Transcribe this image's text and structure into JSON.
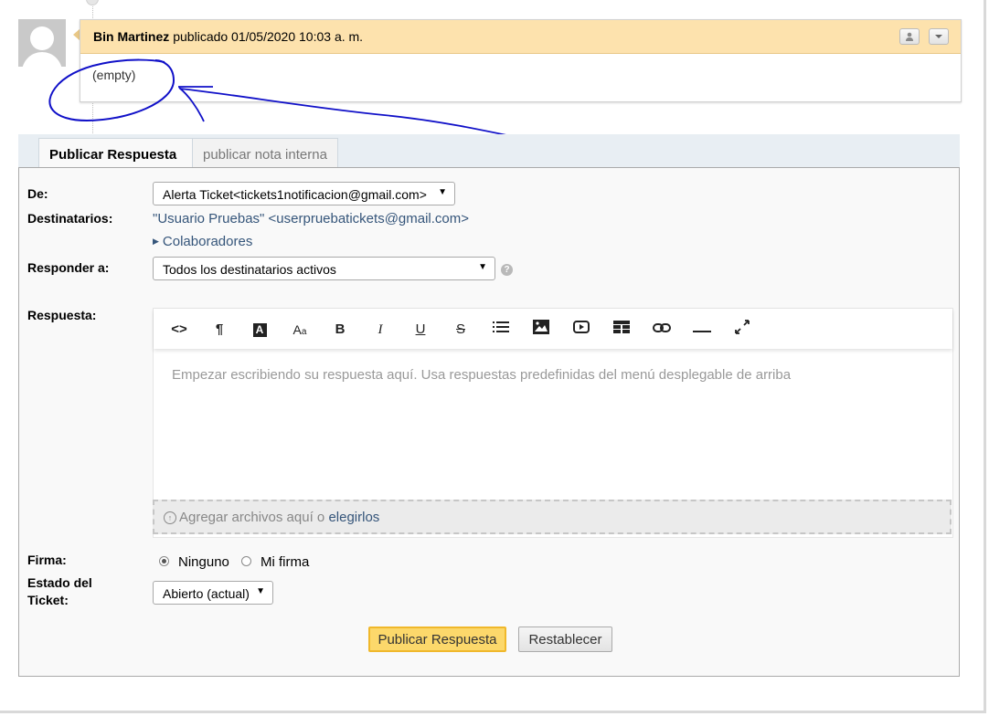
{
  "thread": {
    "poster": "Bin Martinez",
    "published_text": "publicado 01/05/2020 10:03 a. m.",
    "body": "(empty)"
  },
  "tabs": [
    {
      "label": "Publicar Respuesta",
      "active": true
    },
    {
      "label": "publicar nota interna",
      "active": false
    }
  ],
  "form": {
    "from_label": "De:",
    "from_value": "Alerta Ticket<tickets1notificacion@gmail.com>",
    "recipients_label": "Destinatarios:",
    "recipients_value": "\"Usuario Pruebas\" <userpruebatickets@gmail.com>",
    "collaborators_label": "Colaboradores",
    "reply_to_label": "Responder a:",
    "reply_to_value": "Todos los destinatarios activos",
    "response_label": "Respuesta:",
    "editor_placeholder": "Empezar escribiendo su respuesta aquí. Usa respuestas predefinidas del menú desplegable de arriba",
    "dropzone_text": "Agregar archivos aquí o",
    "dropzone_link": "elegirlos",
    "signature_label": "Firma:",
    "signature_options": [
      "Ninguno",
      "Mi firma"
    ],
    "signature_selected": "Ninguno",
    "status_label_line1": "Estado del",
    "status_label_line2": "Ticket:",
    "status_value": "Abierto (actual)",
    "submit_label": "Publicar Respuesta",
    "reset_label": "Restablecer"
  },
  "toolbar": [
    {
      "icon": "code-view-icon",
      "glyph": "<>"
    },
    {
      "icon": "paragraph-icon",
      "glyph": "¶"
    },
    {
      "icon": "font-color-icon",
      "glyph": "A"
    },
    {
      "icon": "font-size-icon",
      "glyph": "Aa"
    },
    {
      "icon": "bold-icon",
      "glyph": "B"
    },
    {
      "icon": "italic-icon",
      "glyph": "I"
    },
    {
      "icon": "underline-icon",
      "glyph": "U"
    },
    {
      "icon": "strikethrough-icon",
      "glyph": "S"
    },
    {
      "icon": "list-icon",
      "glyph": "☰"
    },
    {
      "icon": "image-icon",
      "glyph": "img"
    },
    {
      "icon": "video-icon",
      "glyph": "▶"
    },
    {
      "icon": "table-icon",
      "glyph": "tbl"
    },
    {
      "icon": "link-icon",
      "glyph": "🔗"
    },
    {
      "icon": "horizontal-rule-icon",
      "glyph": "—"
    },
    {
      "icon": "fullscreen-icon",
      "glyph": "⤢"
    }
  ],
  "colors": {
    "thread_header_bg": "#fde2ad",
    "link": "#35557a",
    "primary_button": "#fcd86b",
    "annotation_ink": "#1010c8"
  }
}
